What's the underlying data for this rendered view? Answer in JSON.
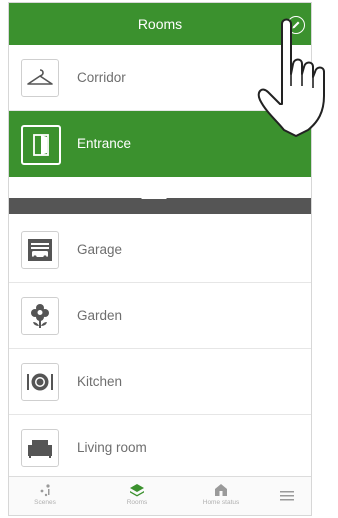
{
  "header": {
    "title": "Rooms",
    "edit_icon": "pencil-icon"
  },
  "rooms": [
    {
      "label": "Corridor",
      "icon": "hanger-icon"
    },
    {
      "label": "Entrance",
      "icon": "door-icon",
      "selected": true
    },
    {
      "label": "Garage",
      "icon": "garage-icon"
    },
    {
      "label": "Garden",
      "icon": "flower-icon"
    },
    {
      "label": "Kitchen",
      "icon": "plate-icon"
    },
    {
      "label": "Living room",
      "icon": "sofa-icon"
    }
  ],
  "nav": [
    {
      "label": "Scenes",
      "icon": "scenes-icon"
    },
    {
      "label": "Rooms",
      "icon": "rooms-icon",
      "active": true
    },
    {
      "label": "Home status",
      "icon": "home-status-icon"
    },
    {
      "label": "",
      "icon": "menu-icon"
    }
  ],
  "colors": {
    "accent": "#3b912e",
    "divider": "#555555"
  }
}
